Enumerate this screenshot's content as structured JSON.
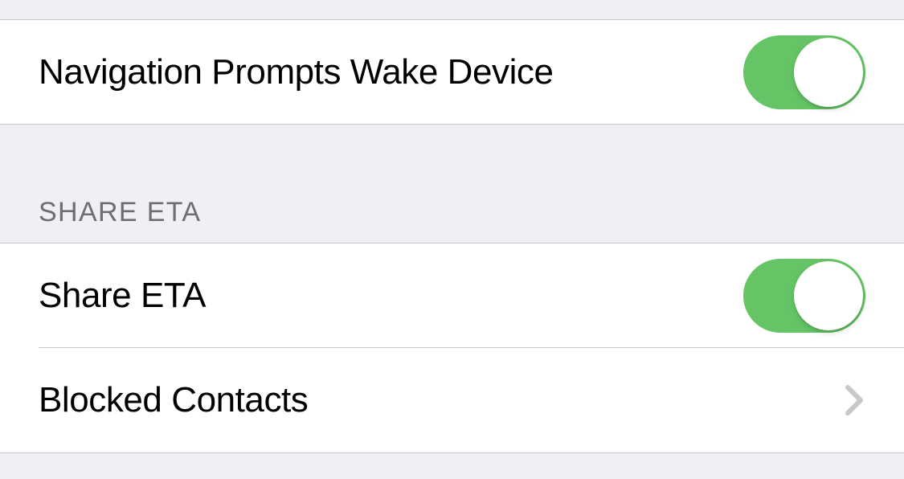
{
  "rows": {
    "navigation_prompts": {
      "label": "Navigation Prompts Wake Device",
      "toggle_on": true
    }
  },
  "sections": {
    "share_eta": {
      "header": "SHARE ETA",
      "rows": {
        "share_eta": {
          "label": "Share ETA",
          "toggle_on": true
        },
        "blocked_contacts": {
          "label": "Blocked Contacts"
        }
      }
    }
  },
  "colors": {
    "toggle_on": "#65c566",
    "background": "#efeff4",
    "row_background": "#ffffff",
    "separator": "#c8c7cc",
    "header_text": "#6d6d72"
  }
}
